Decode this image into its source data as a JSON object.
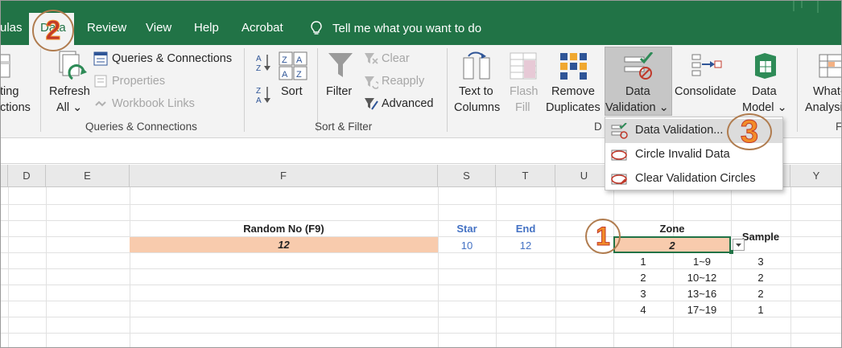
{
  "tabs": {
    "formulas_partial": "ulas",
    "data": "Data",
    "review": "Review",
    "view": "View",
    "help": "Help",
    "acrobat": "Acrobat"
  },
  "tell_me": "Tell me what you want to do",
  "ribbon": {
    "get_partial_1": "ting",
    "get_partial_2": "ctions",
    "refresh_line1": "Refresh",
    "refresh_line2": "All",
    "queries_connections": "Queries & Connections",
    "properties": "Properties",
    "workbook_links": "Workbook Links",
    "group_queries": "Queries & Connections",
    "sort": "Sort",
    "filter": "Filter",
    "clear": "Clear",
    "reapply": "Reapply",
    "advanced": "Advanced",
    "group_sort_filter": "Sort & Filter",
    "text_to_columns_1": "Text to",
    "text_to_columns_2": "Columns",
    "flash_fill_1": "Flash",
    "flash_fill_2": "Fill",
    "remove_dup_1": "Remove",
    "remove_dup_2": "Duplicates",
    "data_validation_1": "Data",
    "data_validation_2": "Validation",
    "consolidate": "Consolidate",
    "data_model_1": "Data",
    "data_model_2": "Model",
    "whatif_1": "What-",
    "whatif_2": "Analysi",
    "group_data_tools_partial": "D",
    "group_forecast_partial": "F"
  },
  "menu": {
    "item1": "Data Validation...",
    "item2": "Circle Invalid Data",
    "item3": "Clear Validation Circles"
  },
  "columns": [
    "D",
    "E",
    "F",
    "S",
    "T",
    "U",
    "Y"
  ],
  "sheet": {
    "random_header": "Random No (F9)",
    "random_value": "12",
    "star_header": "Star",
    "star_value": "10",
    "end_header": "End",
    "end_value": "12",
    "zone_header": "Zone",
    "zone_value": "2",
    "sample_header": "Sample",
    "table": [
      {
        "id": "1",
        "range": "1~9",
        "sample": "3"
      },
      {
        "id": "2",
        "range": "10~12",
        "sample": "2"
      },
      {
        "id": "3",
        "range": "13~16",
        "sample": "2"
      },
      {
        "id": "4",
        "range": "17~19",
        "sample": "1"
      }
    ]
  },
  "badges": {
    "b1": "1",
    "b2": "2",
    "b3": "3"
  },
  "colors": {
    "excel_green": "#217346",
    "peach": "#f8cbad",
    "blue_header": "#4472c4",
    "badge_orange": "#f28c28",
    "badge_red": "#c0392b"
  }
}
